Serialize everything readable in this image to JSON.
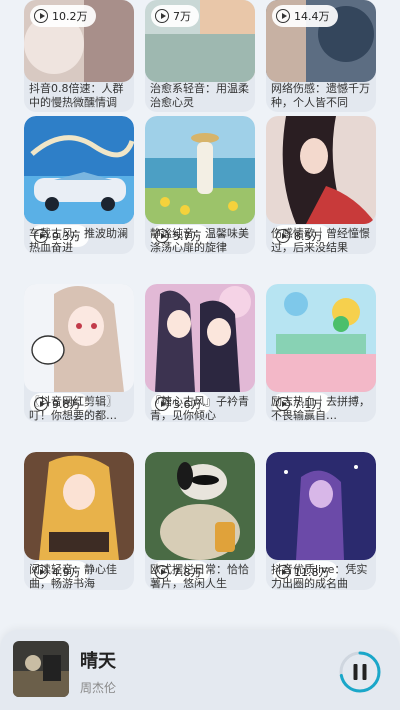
{
  "cards": [
    {
      "plays": "10.2万",
      "title": "抖音0.8倍速：人群中的慢热微醺情调"
    },
    {
      "plays": "7万",
      "title": "治愈系轻音：用温柔治愈心灵"
    },
    {
      "plays": "14.4万",
      "title": "网络伤感：遗憾千万种，个人皆不同"
    },
    {
      "plays": "9.3万",
      "title": "车载古风：推波助澜热血奋进"
    },
    {
      "plays": "5.7万",
      "title": "静谧纯音：温馨味美涤荡心扉的旋律"
    },
    {
      "plays": "8.5万",
      "title": "伤感情歌｜曾经憧憬过，后来没结果"
    },
    {
      "plays": "9.8万",
      "title": "〖抖音网红剪辑〗叮！你想要的都…"
    },
    {
      "plays": "3.6万",
      "title": "『糖心古风』子衿青青，见你倾心"
    },
    {
      "plays": "7.1万",
      "title": "励志热血｜去拼搏，不畏输赢自…"
    },
    {
      "plays": "4.9万",
      "title": "阅读轻音：静心佳曲，畅游书海"
    },
    {
      "plays": "7.8万",
      "title": "欧式摆烂日常：恰恰薯片，悠闲人生"
    },
    {
      "plays": "11.8万",
      "title": "抖音优质live：凭实力出圈的成名曲"
    }
  ],
  "player": {
    "title": "晴天",
    "artist": "周杰伦",
    "pause_icon": "pause-icon",
    "progress": 0.72
  },
  "colors": {
    "accent": "#1aa7c9",
    "card_bg": "#e3e8ef"
  }
}
